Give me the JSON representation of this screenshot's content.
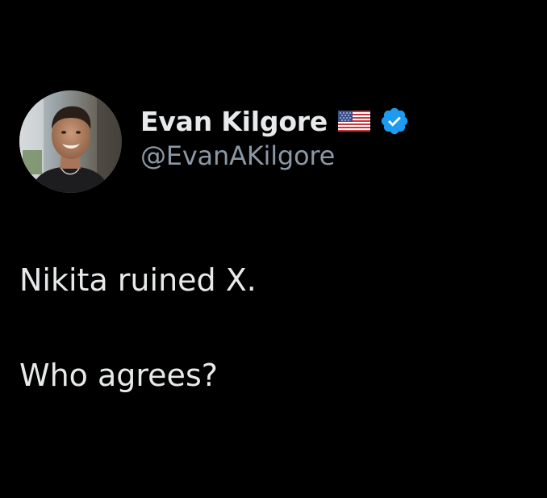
{
  "author": {
    "display_name": "Evan Kilgore",
    "handle": "@EvanAKilgore",
    "flag_icon": "us-flag-icon",
    "verified_icon": "verified-badge-icon",
    "verified_color": "#1d9bf0"
  },
  "tweet": {
    "line_1": "Nikita ruined X.",
    "line_2": "Who agrees?"
  },
  "colors": {
    "background": "#000000",
    "text": "#e7e9ea",
    "secondary_text": "#8b98a5"
  }
}
